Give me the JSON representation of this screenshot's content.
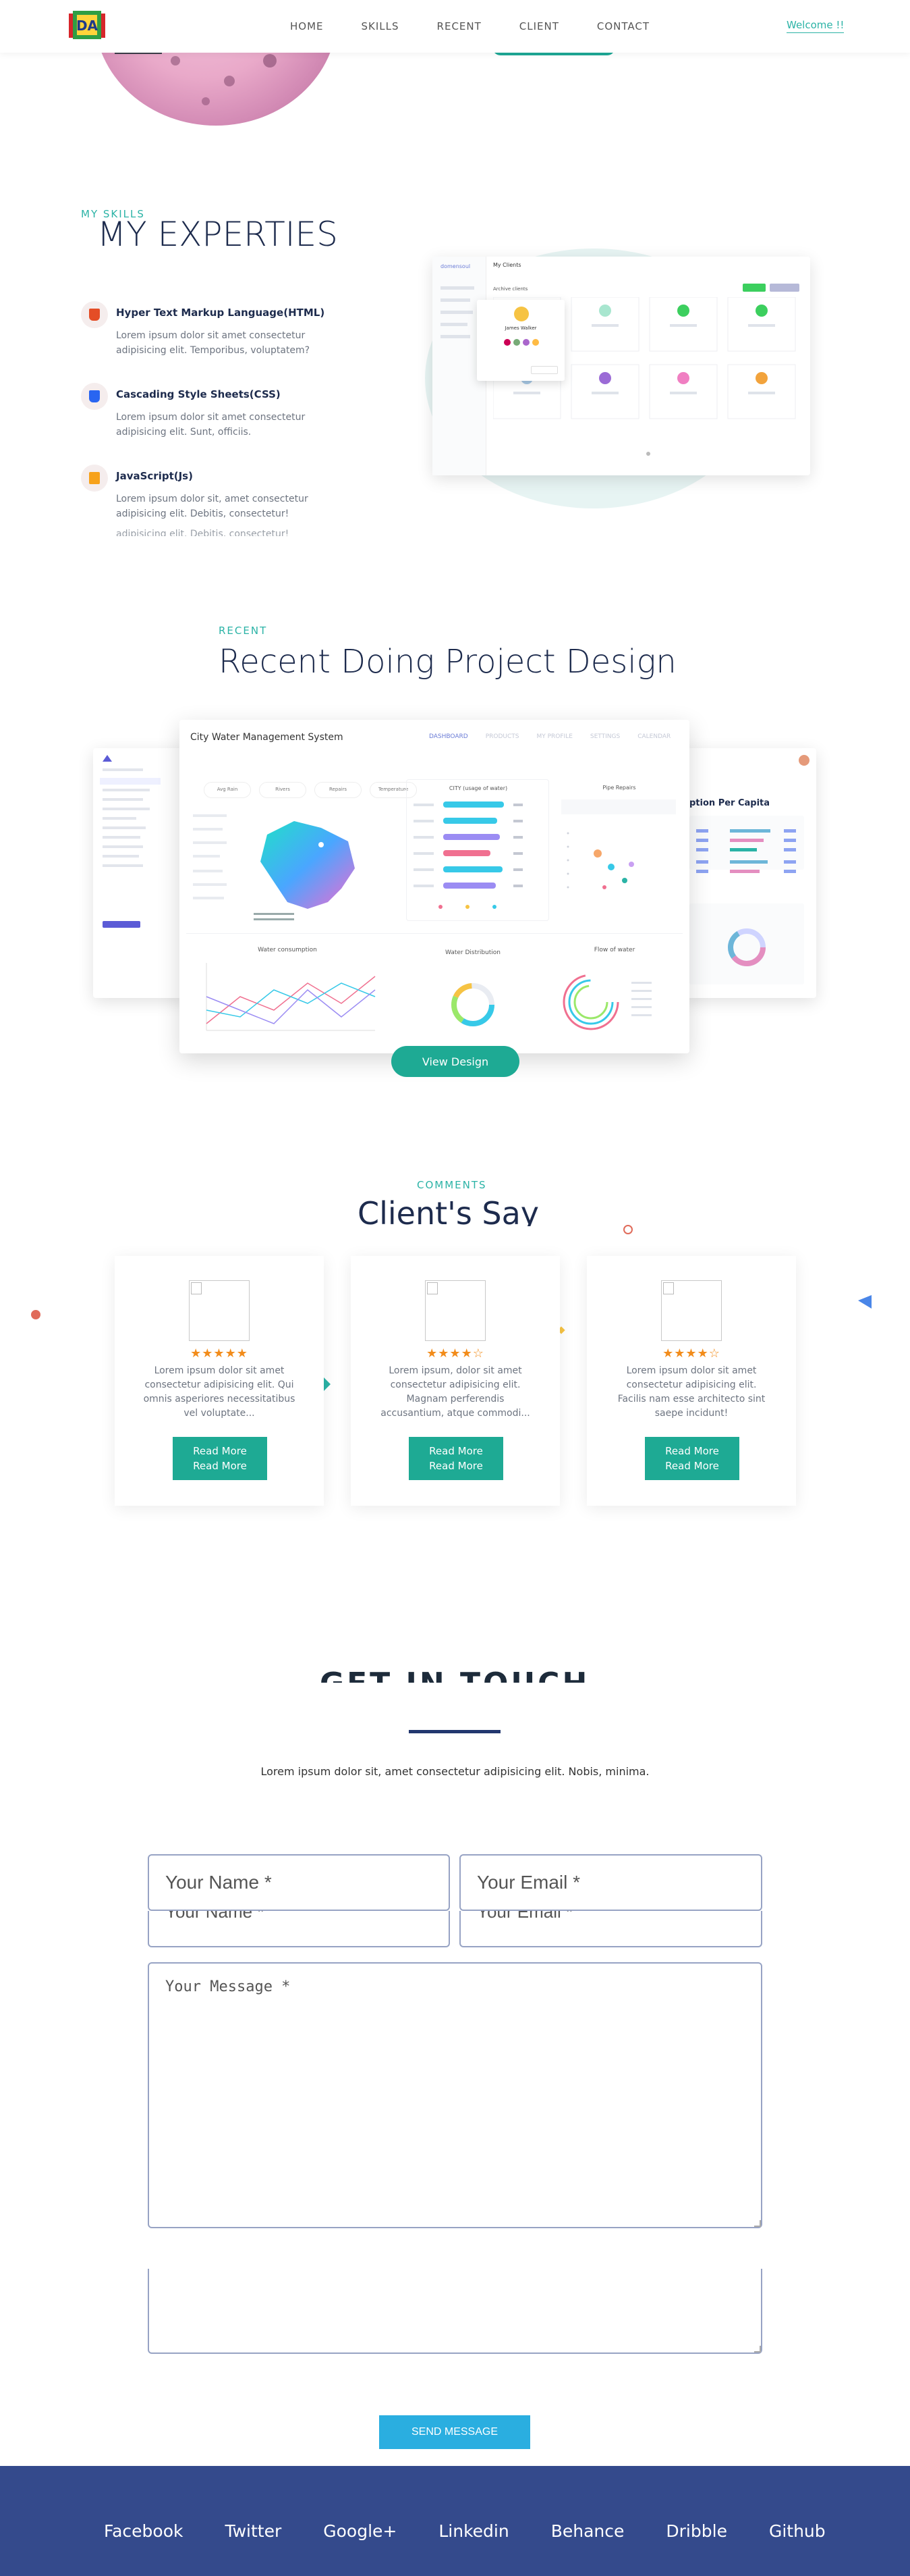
{
  "nav": {
    "logo_text": "DA",
    "links": [
      "HOME",
      "SKILLS",
      "RECENT",
      "CLIENT",
      "CONTACT"
    ],
    "welcome": "Welcome !!"
  },
  "skills": {
    "eyebrow": "MY SKILLS",
    "title": "MY EXPERTIES",
    "items": [
      {
        "title": "Hyper Text Markup Language(HTML)",
        "desc": "Lorem ipsum dolor sit amet consectetur adipisicing elit. Temporibus, voluptatem?",
        "icon": "html5-icon"
      },
      {
        "title": "Cascading Style Sheets(CSS)",
        "desc": "Lorem ipsum dolor sit amet consectetur adipisicing elit. Sunt, officiis.",
        "icon": "css3-icon"
      },
      {
        "title": "JavaScript(Js)",
        "desc": "Lorem ipsum dolor sit, amet consectetur adipisicing elit. Debitis, consectetur!",
        "icon": "javascript-icon"
      }
    ],
    "clipped_line": "adipisicing elit. Debitis, consectetur!",
    "mock": {
      "brand": "domensoul",
      "header": "My Clients",
      "subtitle": "Archive clients",
      "user": "James Walker"
    }
  },
  "recent": {
    "eyebrow": "RECENT",
    "title": "Recent Doing Project Design",
    "dashboard_title": "City Water Management System",
    "dashboard_tabs": [
      "DASHBOARD",
      "PRODUCTS",
      "MY PROFILE",
      "SETTINGS",
      "CALENDAR"
    ],
    "stats": [
      "Avg Rain",
      "Rivers",
      "Repairs",
      "Temperature"
    ],
    "usage_title": "CITY (usage of water)",
    "pipe_title": "Pipe Repairs",
    "bottom_titles": [
      "Water consumption",
      "Water Distribution",
      "Flow of water"
    ],
    "right_title": "ption Per Capita",
    "view_button": "View Design"
  },
  "comments": {
    "eyebrow": "COMMENTS",
    "title": "Client's Say",
    "cards": [
      {
        "stars": "★★★★★",
        "text": "Lorem ipsum dolor sit amet consectetur adipisicing elit. Qui omnis asperiores necessitatibus vel voluptate...",
        "button": [
          "Read More",
          "Read More"
        ]
      },
      {
        "stars": "★★★★☆",
        "text": "Lorem ipsum, dolor sit amet consectetur adipisicing elit. Magnam perferendis accusantium, atque commodi...",
        "button": [
          "Read More",
          "Read More"
        ]
      },
      {
        "stars": "★★★★☆",
        "text": "Lorem ipsum dolor sit amet consectetur adipisicing elit. Facilis nam esse architecto sint saepe incidunt!",
        "button": [
          "Read More",
          "Read More"
        ]
      }
    ]
  },
  "contact": {
    "title": "GET IN TOUCH",
    "subtitle": "Lorem ipsum dolor sit, amet consectetur adipisicing elit. Nobis, minima.",
    "name_placeholder": "Your Name *",
    "email_placeholder": "Your Email *",
    "message_placeholder": "Your Message *",
    "send": "SEND MESSAGE"
  },
  "footer": {
    "links": [
      "Facebook",
      "Twitter",
      "Google+",
      "Linkedin",
      "Behance",
      "Dribble",
      "Github"
    ]
  },
  "colors": {
    "accent": "#1eaa94",
    "navy": "#1d2b4d",
    "footer": "#344a8c",
    "send": "#2aaee0",
    "star": "#f28c1b"
  }
}
